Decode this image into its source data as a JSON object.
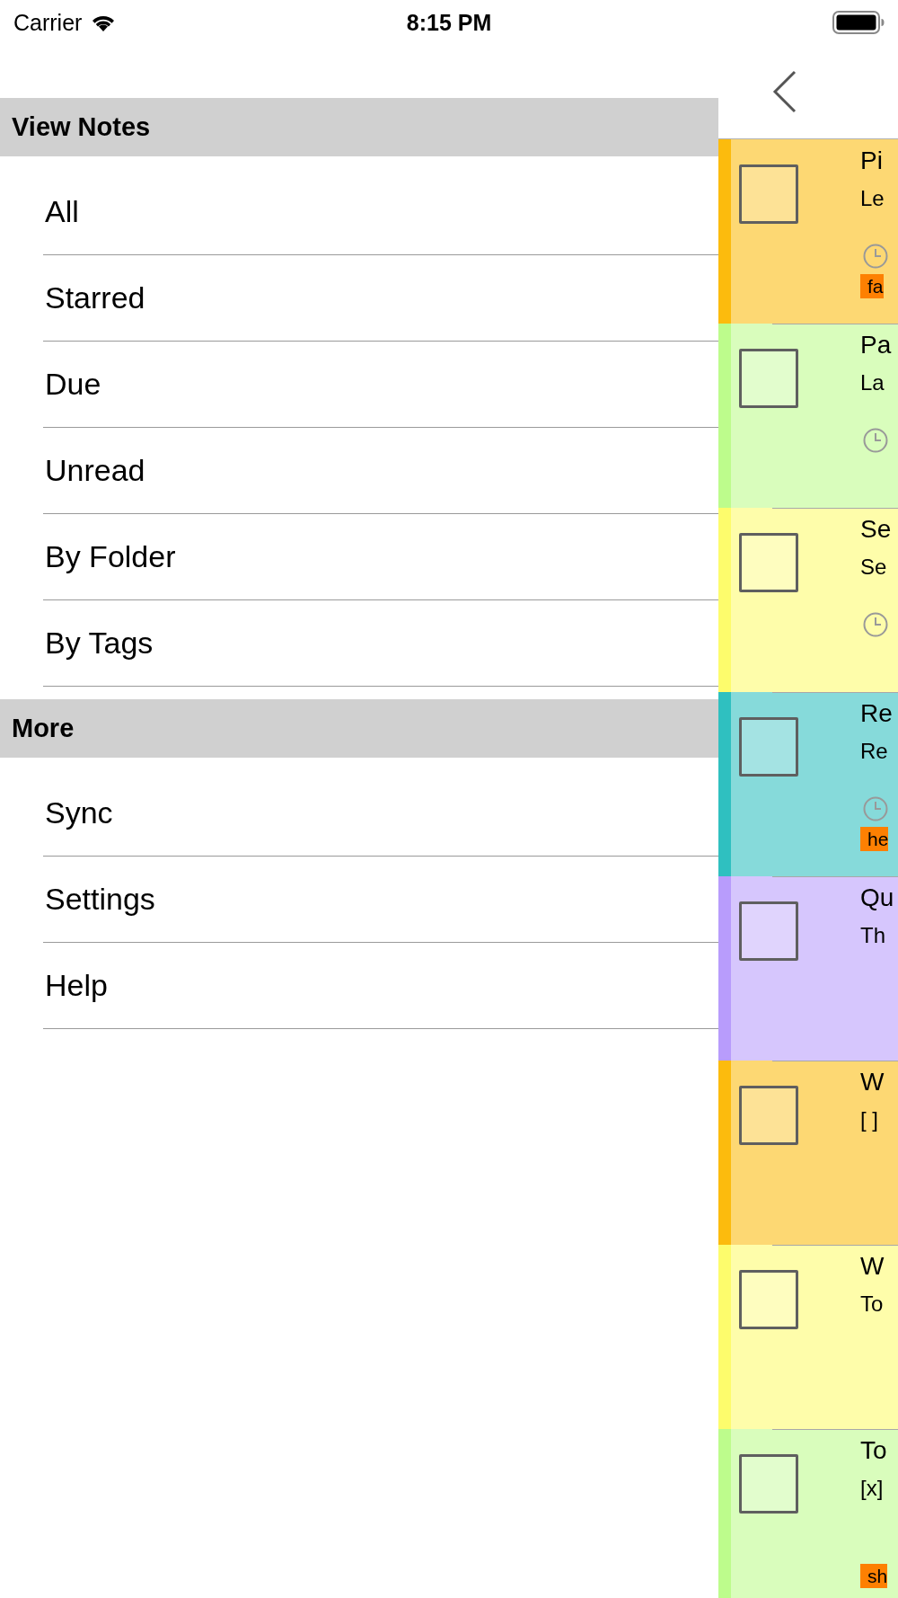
{
  "status_bar": {
    "carrier": "Carrier",
    "time": "8:15 PM"
  },
  "menu": {
    "sections": [
      {
        "title": "View Notes",
        "items": [
          {
            "label": "All",
            "selected": false
          },
          {
            "label": "Starred",
            "selected": false
          },
          {
            "label": "Due",
            "selected": false
          },
          {
            "label": "Unread",
            "selected": false
          },
          {
            "label": "By Folder",
            "selected": false
          },
          {
            "label": "By Tags",
            "selected": false
          }
        ]
      },
      {
        "title": "More",
        "items": [
          {
            "label": "Sync",
            "selected": false
          },
          {
            "label": "Settings",
            "selected": false
          },
          {
            "label": "Help",
            "selected": false
          }
        ]
      }
    ]
  },
  "notes": [
    {
      "title": "Pi",
      "preview": "Le",
      "due": true,
      "tag": "fa",
      "color": "#fcbb0d",
      "checked": false
    },
    {
      "title": "Pa",
      "preview": "La",
      "due": true,
      "color": "#bdfc8c",
      "checked": false
    },
    {
      "title": "Se",
      "preview": "Se",
      "due": true,
      "color": "#fdfc6c",
      "checked": false
    },
    {
      "title": "Re",
      "preview": "Re",
      "due": true,
      "tag": "he",
      "color": "#2fc0c0",
      "checked": false
    },
    {
      "title": "Qu",
      "preview": "Th",
      "due": false,
      "color": "#b89cfc",
      "checked": false
    },
    {
      "title": "W",
      "preview": "[ ]",
      "due": false,
      "color": "#fcbb0d",
      "checked": false
    },
    {
      "title": "W",
      "preview": "To",
      "due": false,
      "color": "#fdfc6c",
      "checked": false
    },
    {
      "title": "To",
      "preview": "[x]",
      "due": false,
      "tag": "sh",
      "color": "#bdfc8c",
      "checked": false
    }
  ]
}
